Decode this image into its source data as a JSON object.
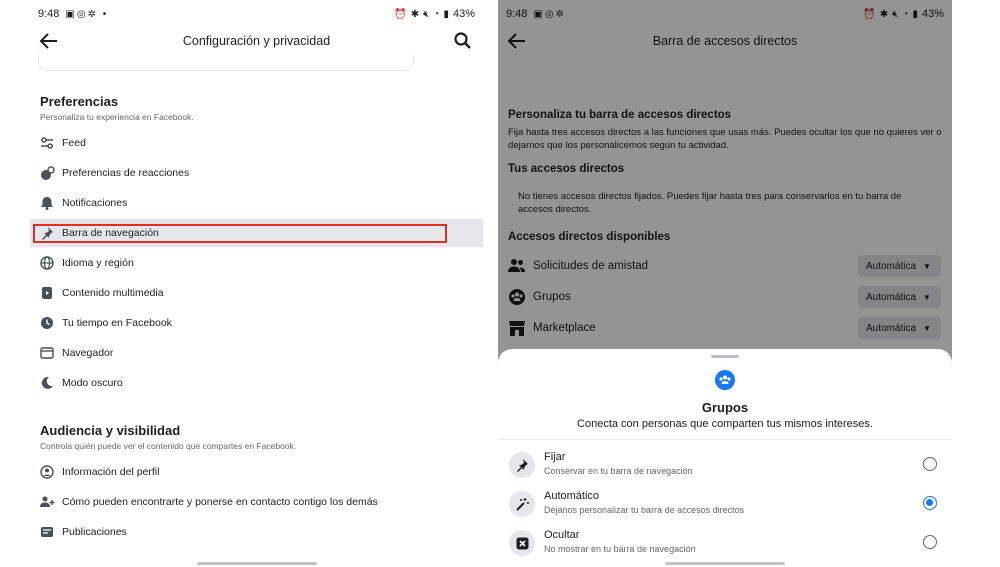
{
  "left": {
    "status": {
      "time": "9:48",
      "battery": "43%"
    },
    "appbar_title": "Configuración y privacidad",
    "preferences": {
      "title": "Preferencias",
      "subtitle": "Personaliza tu experiencia en Facebook.",
      "items": [
        {
          "label": "Feed",
          "icon": "sliders-icon"
        },
        {
          "label": "Preferencias de reacciones",
          "icon": "reactions-icon"
        },
        {
          "label": "Notificaciones",
          "icon": "bell-icon"
        },
        {
          "label": "Barra de navegación",
          "icon": "pin-icon"
        },
        {
          "label": "Idioma y región",
          "icon": "globe-icon"
        },
        {
          "label": "Contenido multimedia",
          "icon": "media-icon"
        },
        {
          "label": "Tu tiempo en Facebook",
          "icon": "clock-icon"
        },
        {
          "label": "Navegador",
          "icon": "browser-icon"
        },
        {
          "label": "Modo oscuro",
          "icon": "moon-icon"
        }
      ]
    },
    "audience": {
      "title": "Audiencia y visibilidad",
      "subtitle": "Controla quién puede ver el contenido que compartes en Facebook.",
      "items": [
        {
          "label": "Información del perfil",
          "icon": "profile-icon"
        },
        {
          "label": "Cómo pueden encontrarte y ponerse en contacto contigo los demás",
          "icon": "contact-icon"
        },
        {
          "label": "Publicaciones",
          "icon": "posts-icon"
        }
      ]
    },
    "highlight_color": "#d93025"
  },
  "right": {
    "status": {
      "time": "9:48",
      "battery": "43%"
    },
    "appbar_title": "Barra de accesos directos",
    "personalize_title": "Personaliza tu barra de accesos directos",
    "personalize_text": "Fija hasta tres accesos directos a las funciones que usas más. Puedes ocultar los que no quieres ver o dejarnos que los personalicemos según tu actividad.",
    "your_shortcuts_title": "Tus accesos directos",
    "your_shortcuts_text": "No tienes accesos directos fijados. Puedes fijar hasta tres para conservarlos en tu barra de accesos directos.",
    "available_title": "Accesos directos disponibles",
    "shortcuts": [
      {
        "label": "Solicitudes de amistad",
        "value": "Automática",
        "icon": "friends-icon"
      },
      {
        "label": "Grupos",
        "value": "Automática",
        "icon": "groups-icon"
      },
      {
        "label": "Marketplace",
        "value": "Automática",
        "icon": "marketplace-icon"
      }
    ],
    "sheet": {
      "title": "Grupos",
      "subtitle": "Conecta con personas que comparten tus mismos intereses.",
      "options": [
        {
          "label": "Fijar",
          "desc": "Conservar en tu barra de navegación",
          "icon": "pin-icon",
          "selected": false
        },
        {
          "label": "Automático",
          "desc": "Déjanos personalizar tu barra de accesos directos",
          "icon": "magic-wand-icon",
          "selected": true
        },
        {
          "label": "Ocultar",
          "desc": "No mostrar en tu barra de navegación",
          "icon": "hide-icon",
          "selected": false
        }
      ]
    },
    "accent_color": "#1877f2"
  }
}
